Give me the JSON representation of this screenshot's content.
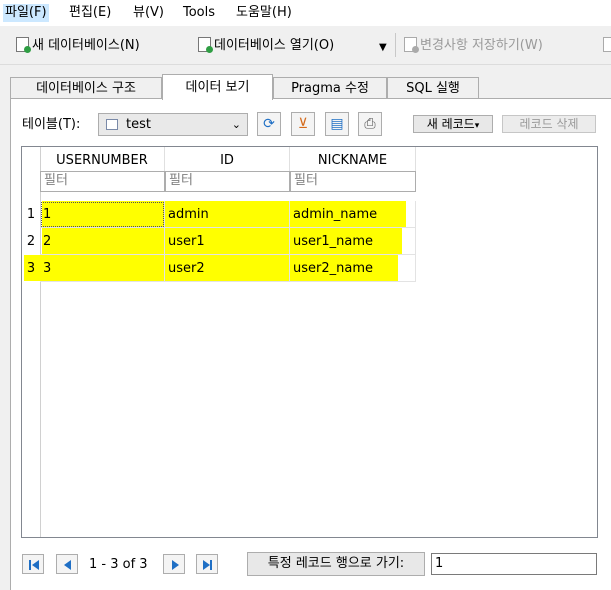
{
  "menu": [
    {
      "label": "파일(F)"
    },
    {
      "label": "편집(E)"
    },
    {
      "label": "뷰(V)"
    },
    {
      "label": "Tools"
    },
    {
      "label": "도움말(H)"
    }
  ],
  "toolbar": {
    "new_db": "새 데이터베이스(N)",
    "open_db": "데이터베이스 열기(O)",
    "write_changes": "변경사항 저장하기(W)"
  },
  "tabs": [
    "데이터베이스 구조",
    "데이터 보기",
    "Pragma 수정",
    "SQL 실행"
  ],
  "browse": {
    "table_label": "테이블(T):",
    "table_value": "test",
    "new_record": "새 레코드",
    "delete_record": "레코드 삭제"
  },
  "grid": {
    "columns": [
      "USERNUMBER",
      "ID",
      "NICKNAME"
    ],
    "filter_placeholder": "필터",
    "rows": [
      {
        "no": "1",
        "cells": [
          "1",
          "admin",
          "admin_name"
        ]
      },
      {
        "no": "2",
        "cells": [
          "2",
          "user1",
          "user1_name"
        ]
      },
      {
        "no": "3",
        "cells": [
          "3",
          "user2",
          "user2_name"
        ]
      }
    ]
  },
  "pager": {
    "text": "1 - 3 of 3",
    "goto_label": "특정 레코드 행으로 가기:",
    "goto_value": "1"
  },
  "colors": {
    "highlight": "#ffff00",
    "accent": "#1f6fc5"
  }
}
